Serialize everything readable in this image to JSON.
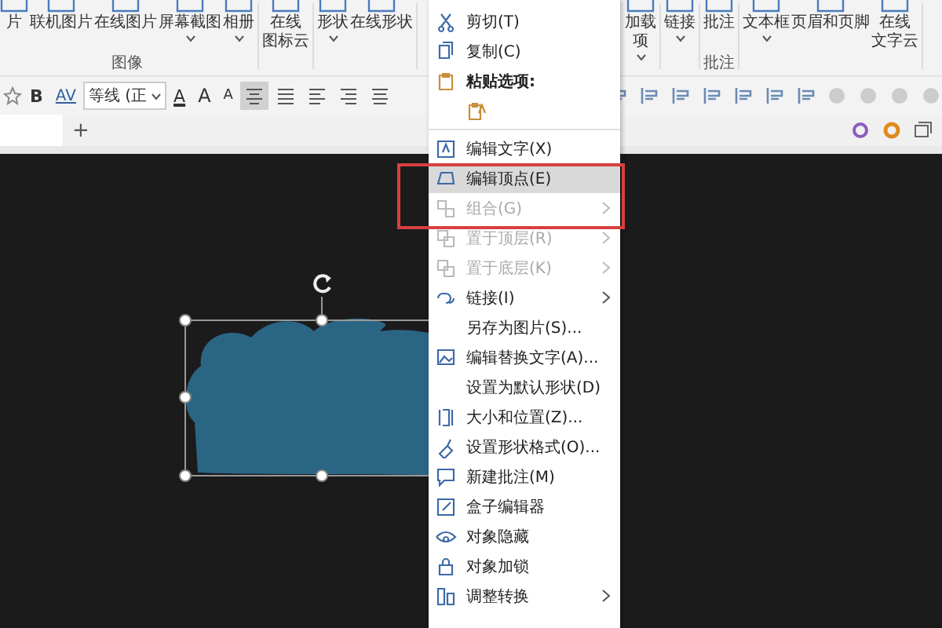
{
  "ribbon_left": [
    {
      "label": "图像",
      "items": [
        {
          "label": "片",
          "caret": false
        },
        {
          "label": "联机图片",
          "caret": false
        },
        {
          "label": "在线图片",
          "caret": false
        },
        {
          "label": "屏幕截图",
          "caret": true
        },
        {
          "label": "相册",
          "caret": true
        }
      ]
    },
    {
      "items": [
        {
          "lines": [
            "在线",
            "图标云"
          ],
          "caret": false
        }
      ]
    },
    {
      "items": [
        {
          "label": "形状",
          "caret": true
        },
        {
          "label": "在线形状",
          "caret": false
        }
      ]
    }
  ],
  "ribbon_right": [
    {
      "items": [
        {
          "lines": [
            "加载",
            "项"
          ],
          "caret": true
        }
      ]
    },
    {
      "items": [
        {
          "label": "链接",
          "caret": true
        }
      ]
    },
    {
      "label": "批注",
      "items": [
        {
          "label": "批注",
          "caret": false
        }
      ]
    },
    {
      "items": [
        {
          "label": "文本框",
          "caret": true
        },
        {
          "label": "页眉和页脚",
          "caret": false
        },
        {
          "lines": [
            "在线",
            "文字云"
          ],
          "caret": false
        }
      ]
    }
  ],
  "toolbar": {
    "bold": "B",
    "spacing": "AV",
    "font": "等线 (正",
    "font_color": "A",
    "grow": "A",
    "shrink": "A",
    "align": [
      {
        "selected": true
      },
      {
        "selected": false
      },
      {
        "selected": false
      },
      {
        "selected": false
      },
      {
        "selected": false
      }
    ]
  },
  "tab_bar": {
    "add": "+"
  },
  "context_menu": [
    {
      "kind": "item",
      "label": "剪切(T)",
      "disabled": false,
      "submenu": false,
      "highlighted": false
    },
    {
      "kind": "item",
      "label": "复制(C)",
      "disabled": false,
      "submenu": false,
      "highlighted": false
    },
    {
      "kind": "header",
      "label": "粘贴选项:"
    },
    {
      "kind": "paste-options"
    },
    {
      "kind": "separator"
    },
    {
      "kind": "item",
      "label": "编辑文字(X)",
      "disabled": false,
      "submenu": false,
      "highlighted": false
    },
    {
      "kind": "item",
      "label": "编辑顶点(E)",
      "disabled": false,
      "submenu": false,
      "highlighted": true
    },
    {
      "kind": "item",
      "label": "组合(G)",
      "disabled": true,
      "submenu": true,
      "highlighted": false
    },
    {
      "kind": "item",
      "label": "置于顶层(R)",
      "disabled": true,
      "submenu": true,
      "highlighted": false
    },
    {
      "kind": "item",
      "label": "置于底层(K)",
      "disabled": true,
      "submenu": true,
      "highlighted": false
    },
    {
      "kind": "item",
      "label": "链接(I)",
      "disabled": false,
      "submenu": true,
      "highlighted": false
    },
    {
      "kind": "item",
      "label": "另存为图片(S)...",
      "disabled": false,
      "submenu": false,
      "highlighted": false
    },
    {
      "kind": "item",
      "label": "编辑替换文字(A)...",
      "disabled": false,
      "submenu": false,
      "highlighted": false
    },
    {
      "kind": "item",
      "label": "设置为默认形状(D)",
      "disabled": false,
      "submenu": false,
      "highlighted": false
    },
    {
      "kind": "item",
      "label": "大小和位置(Z)...",
      "disabled": false,
      "submenu": false,
      "highlighted": false
    },
    {
      "kind": "item",
      "label": "设置形状格式(O)...",
      "disabled": false,
      "submenu": false,
      "highlighted": false
    },
    {
      "kind": "item",
      "label": "新建批注(M)",
      "disabled": false,
      "submenu": false,
      "highlighted": false
    },
    {
      "kind": "item",
      "label": "盒子编辑器",
      "disabled": false,
      "submenu": false,
      "highlighted": false
    },
    {
      "kind": "item",
      "label": "对象隐藏",
      "disabled": false,
      "submenu": false,
      "highlighted": false
    },
    {
      "kind": "item",
      "label": "对象加锁",
      "disabled": false,
      "submenu": false,
      "highlighted": false
    },
    {
      "kind": "item",
      "label": "调整转换",
      "disabled": false,
      "submenu": true,
      "highlighted": false
    }
  ]
}
